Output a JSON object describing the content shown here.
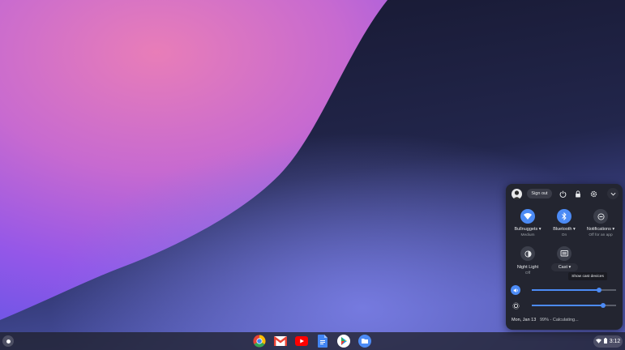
{
  "wallpaper": {
    "colors": [
      "#e87db8",
      "#9457e8",
      "#1e1f3f"
    ]
  },
  "shelf": {
    "launcher_icon": "launcher-icon",
    "apps": [
      {
        "name": "chrome-icon",
        "color": "#ea4335"
      },
      {
        "name": "gmail-icon",
        "color": "#ffffff"
      },
      {
        "name": "youtube-icon",
        "color": "#ff0000"
      },
      {
        "name": "docs-icon",
        "color": "#4285f4"
      },
      {
        "name": "play-store-icon",
        "color": "#34a853"
      },
      {
        "name": "files-icon",
        "color": "#4c8bf5"
      }
    ],
    "tray": {
      "time": "3:12",
      "icons": [
        "wifi-icon",
        "battery-icon"
      ]
    }
  },
  "quick_settings": {
    "header": {
      "sign_out_label": "Sign out",
      "icons": [
        "power-icon",
        "lock-icon",
        "settings-icon",
        "collapse-icon"
      ]
    },
    "toggles": [
      {
        "label": "Bullnuggets",
        "sub": "Medium",
        "icon": "wifi-icon",
        "state": "on"
      },
      {
        "label": "Bluetooth",
        "sub": "On",
        "icon": "bluetooth-icon",
        "state": "on"
      },
      {
        "label": "Notifications",
        "sub": "Off for an app",
        "icon": "do-not-disturb-icon",
        "state": "off"
      },
      {
        "label": "Night Light",
        "sub": "Off",
        "icon": "night-light-icon",
        "state": "off"
      },
      {
        "label": "Cast",
        "sub": "",
        "icon": "cast-icon",
        "state": "off"
      }
    ],
    "tooltip": "Show cast devices",
    "sliders": [
      {
        "name": "volume",
        "icon": "volume-icon",
        "level": 0.8
      },
      {
        "name": "brightness",
        "icon": "brightness-icon",
        "level": 0.85
      }
    ],
    "footer": {
      "date": "Mon, Jan 13",
      "battery": "99% - Calculating..."
    },
    "accent_color": "#4c8bf5"
  }
}
